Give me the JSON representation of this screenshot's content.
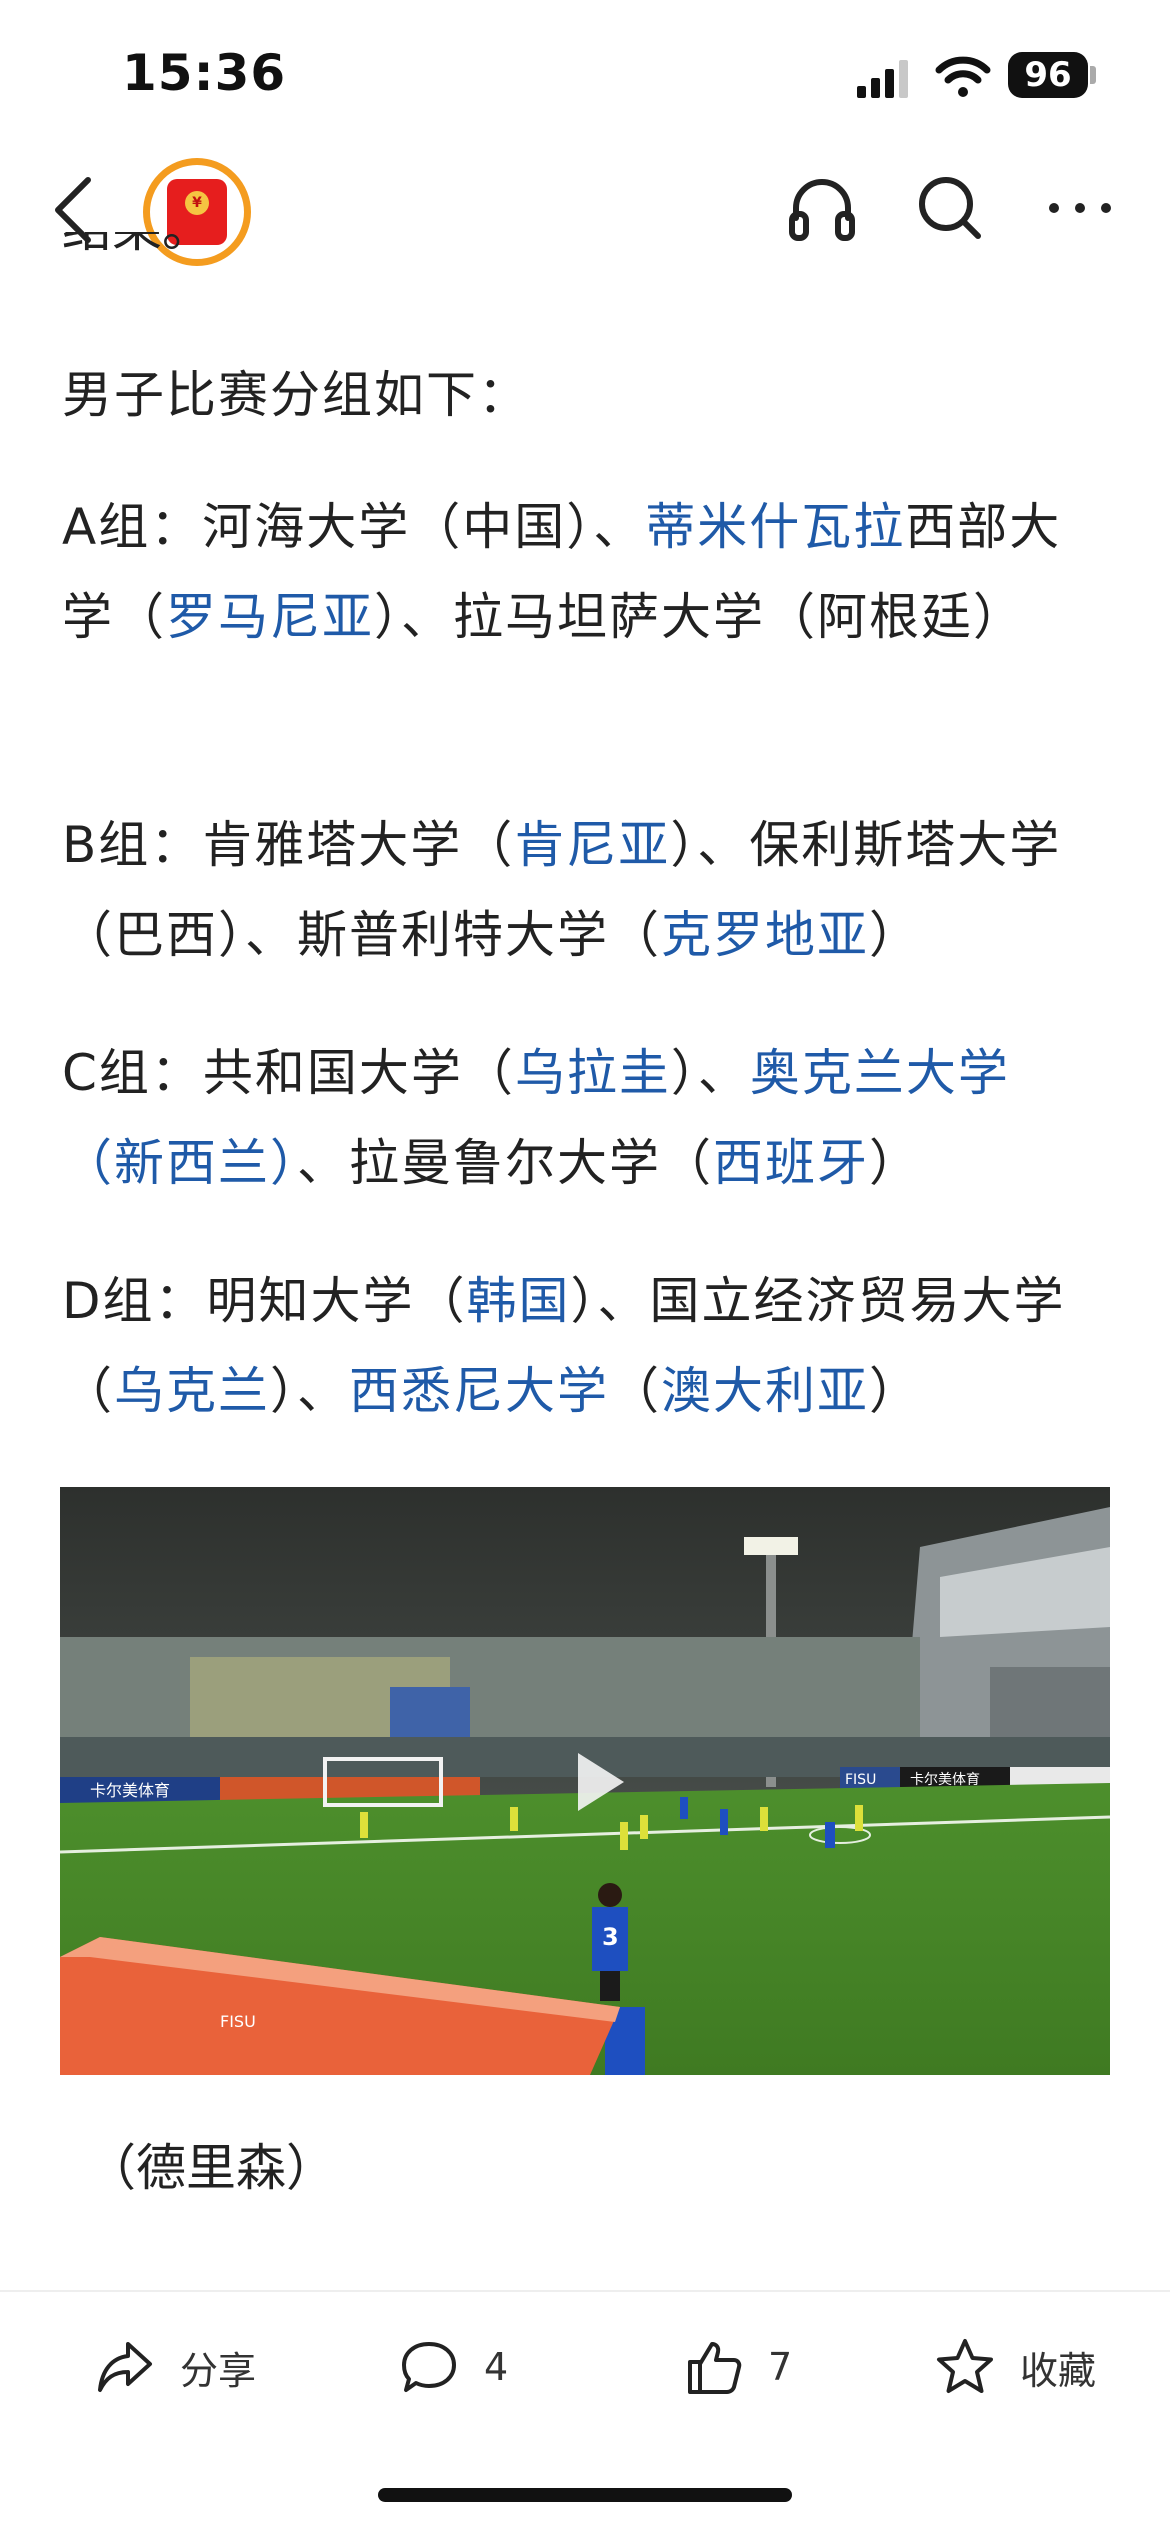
{
  "status_bar": {
    "time": "15:36",
    "battery": "96",
    "icons": [
      "signal-icon",
      "wifi-icon",
      "battery-icon"
    ]
  },
  "nav": {
    "icons": [
      "back-icon",
      "red-envelope-icon",
      "headphones-icon",
      "search-icon",
      "more-icon"
    ],
    "red_envelope_seal": "¥"
  },
  "article": {
    "cut_off_line": "结果。",
    "intro": "男子比赛分组如下：",
    "groups": [
      {
        "label": "A组：",
        "segments": [
          {
            "text": "河海大学（中国）、",
            "link": false
          },
          {
            "text": "蒂米什瓦拉",
            "link": true
          },
          {
            "text": "西部大学（",
            "link": false
          },
          {
            "text": "罗马尼亚",
            "link": true
          },
          {
            "text": "）、拉马坦萨大学（阿根廷）",
            "link": false
          }
        ]
      },
      {
        "label": "B组：",
        "segments": [
          {
            "text": "肯雅塔大学（",
            "link": false
          },
          {
            "text": "肯尼亚",
            "link": true
          },
          {
            "text": "）、保利斯塔大学（巴西）、斯普利特大学（",
            "link": false
          },
          {
            "text": "克罗地亚",
            "link": true
          },
          {
            "text": "）",
            "link": false
          }
        ]
      },
      {
        "label": "C组：",
        "segments": [
          {
            "text": "共和国大学（",
            "link": false
          },
          {
            "text": "乌拉圭",
            "link": true
          },
          {
            "text": "）、",
            "link": false
          },
          {
            "text": "奥克兰大学（新西兰）",
            "link": true
          },
          {
            "text": "、拉曼鲁尔大学（",
            "link": false
          },
          {
            "text": "西班牙",
            "link": true
          },
          {
            "text": "）",
            "link": false
          }
        ]
      },
      {
        "label": "D组：",
        "segments": [
          {
            "text": "明知大学（",
            "link": false
          },
          {
            "text": "韩国",
            "link": true
          },
          {
            "text": "）、国立经济贸易大学（",
            "link": false
          },
          {
            "text": "乌克兰",
            "link": true
          },
          {
            "text": "）、",
            "link": false
          },
          {
            "text": "西悉尼大学",
            "link": true
          },
          {
            "text": "（",
            "link": false
          },
          {
            "text": "澳大利亚",
            "link": true
          },
          {
            "text": "）",
            "link": false
          }
        ]
      }
    ],
    "video": {
      "icon": "play-icon",
      "signs": [
        "卡尔美体育",
        "FISU",
        "卡尔美体育",
        "FISU"
      ],
      "jersey_number": "3"
    },
    "caption": "（德里森）"
  },
  "toolbar": {
    "share_label": "分享",
    "comment_count": "4",
    "like_count": "7",
    "favorite_label": "收藏",
    "icons": [
      "share-icon",
      "comment-icon",
      "like-icon",
      "star-icon"
    ]
  },
  "colors": {
    "link": "#1f5aa8",
    "text": "#222222",
    "envelope_ring": "#f49c1f",
    "envelope_red": "#e61e1e"
  }
}
